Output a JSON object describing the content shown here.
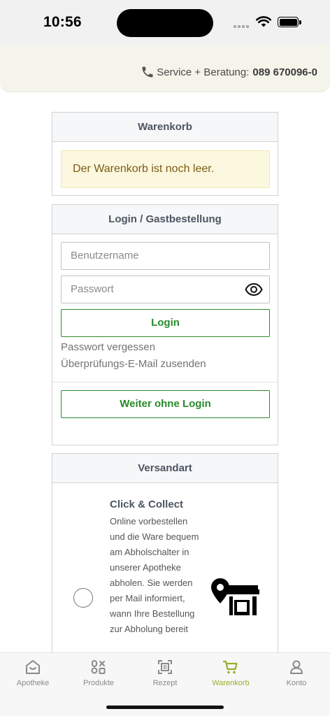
{
  "status": {
    "time": "10:56"
  },
  "header": {
    "service_label": "Service + Beratung:",
    "service_phone": "089 670096-0"
  },
  "cart": {
    "title": "Warenkorb",
    "empty_message": "Der Warenkorb ist noch leer."
  },
  "login": {
    "title": "Login / Gastbestellung",
    "username_placeholder": "Benutzername",
    "password_placeholder": "Passwort",
    "login_button": "Login",
    "forgot_password": "Passwort vergessen",
    "resend_verification": "Überprüfungs-E-Mail zusenden",
    "guest_button": "Weiter ohne Login"
  },
  "shipping": {
    "title": "Versandart",
    "options": [
      {
        "title": "Click & Collect",
        "description": "Online vorbestellen und die Ware bequem am Abholschalter in unserer Apotheke abholen. Sie werden per Mail informiert, wann Ihre Bestellung zur Abholung bereit",
        "icon": "store-location-icon",
        "selected": false
      }
    ]
  },
  "tabs": [
    {
      "label": "Apotheke",
      "icon": "pharmacy-home-icon",
      "active": false
    },
    {
      "label": "Produkte",
      "icon": "products-icon",
      "active": false
    },
    {
      "label": "Rezept",
      "icon": "prescription-scan-icon",
      "active": false
    },
    {
      "label": "Warenkorb",
      "icon": "cart-icon",
      "active": true
    },
    {
      "label": "Konto",
      "icon": "account-icon",
      "active": false
    }
  ],
  "colors": {
    "accent_green": "#2a8a2a",
    "active_tab": "#9aae2c",
    "alert_bg": "#fcf7df"
  }
}
